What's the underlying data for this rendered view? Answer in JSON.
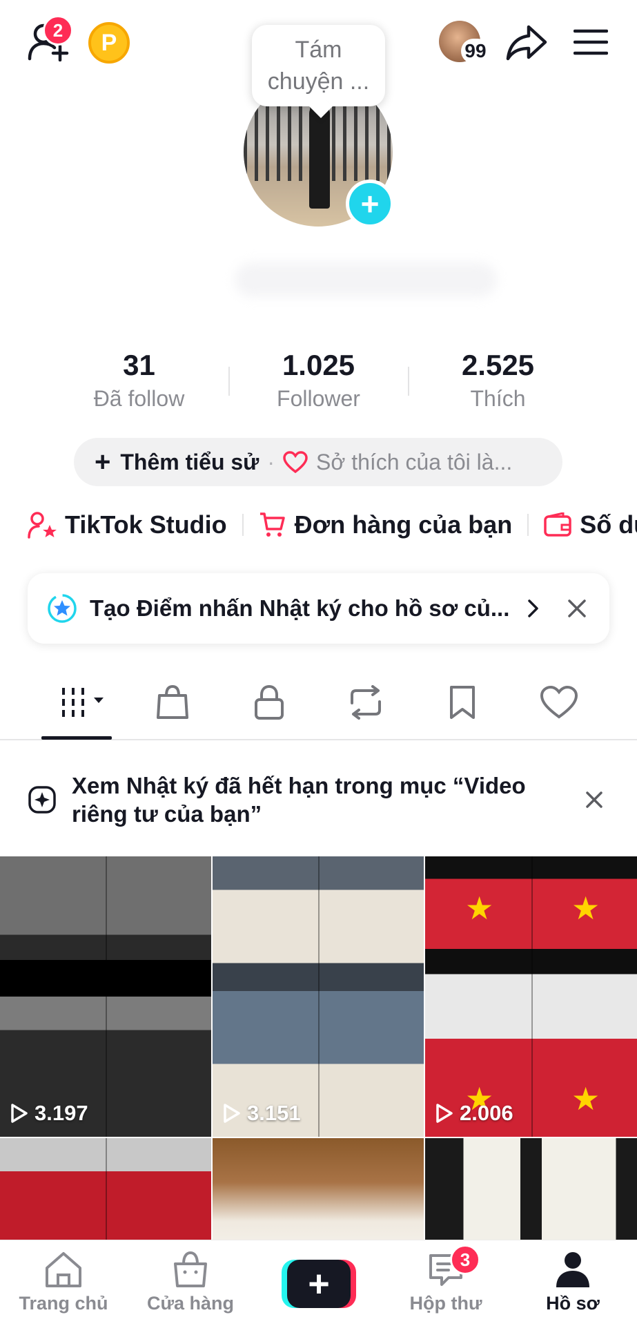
{
  "header": {
    "friends_badge": "2",
    "coin_label": "P",
    "story_bubble": "Tám chuyện ...",
    "inbox_avatar_count": "99"
  },
  "stats": [
    {
      "value": "31",
      "label": "Đã follow"
    },
    {
      "value": "1.025",
      "label": "Follower"
    },
    {
      "value": "2.525",
      "label": "Thích"
    }
  ],
  "bio": {
    "add_label": "Thêm tiểu sử",
    "separator": "·",
    "interest_placeholder": "Sở thích của tôi là..."
  },
  "quick_links": [
    {
      "label": "TikTok Studio",
      "icon": "person-star-icon"
    },
    {
      "label": "Đơn hàng của bạn",
      "icon": "cart-icon"
    },
    {
      "label": "Số dư",
      "icon": "wallet-icon"
    }
  ],
  "banner": {
    "text": "Tạo Điểm nhấn Nhật ký cho hồ sơ củ..."
  },
  "tabs": [
    "videos-grid-icon",
    "shop-bag-icon",
    "lock-icon",
    "repost-icon",
    "bookmark-icon",
    "heart-icon"
  ],
  "notice": {
    "text": "Xem Nhật ký đã hết hạn trong mục “Video riêng tư của bạn”"
  },
  "videos": [
    {
      "views": "3.197"
    },
    {
      "views": "3.151"
    },
    {
      "views": "2.006"
    },
    {
      "views": ""
    },
    {
      "views": ""
    },
    {
      "views": ""
    }
  ],
  "nav": {
    "home": "Trang chủ",
    "shop": "Cửa hàng",
    "create": "+",
    "inbox": "Hộp thư",
    "inbox_badge": "3",
    "profile": "Hồ sơ"
  },
  "colors": {
    "accent": "#fe2c55",
    "cyan": "#20d5ec",
    "text": "#161823",
    "muted": "#8a8b91"
  }
}
